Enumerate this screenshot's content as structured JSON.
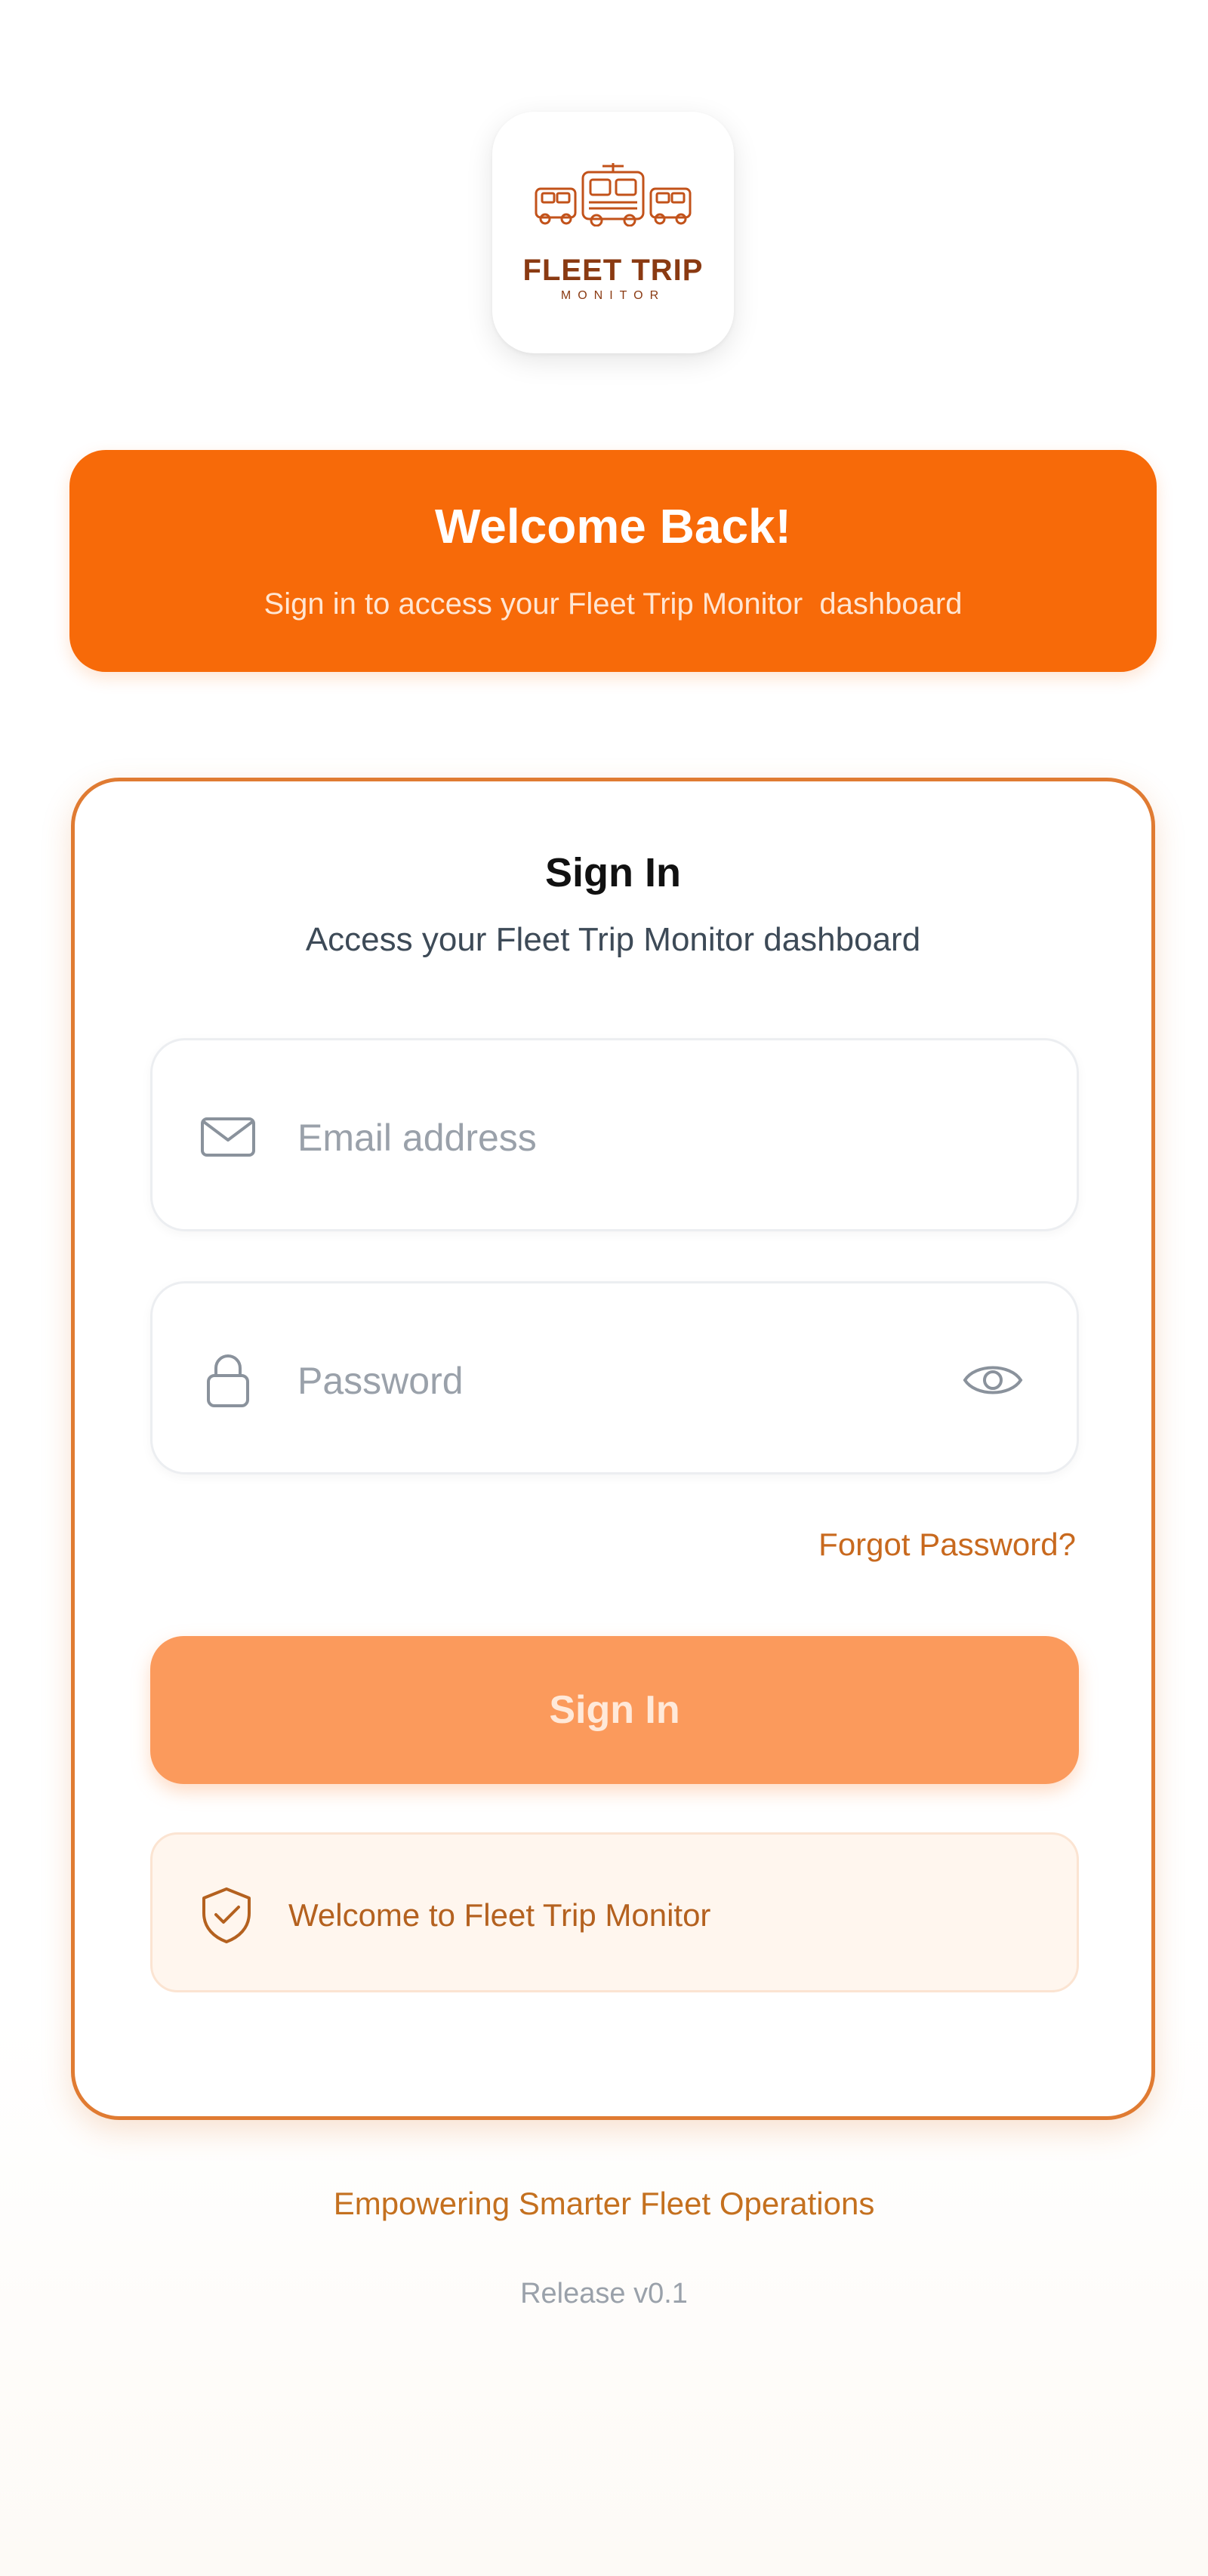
{
  "brand": {
    "logo_name": "FLEET TRIP",
    "logo_sub": "MONITOR",
    "primary_color": "#f76a09",
    "accent_color": "#e07b32",
    "logo_icon": "truck-fleet-icon"
  },
  "banner": {
    "title": "Welcome Back!",
    "subtitle": "Sign in to access your Fleet Trip Monitor  dashboard"
  },
  "signin_card": {
    "title": "Sign In",
    "subtitle": "Access your Fleet Trip Monitor dashboard",
    "email": {
      "placeholder": "Email address",
      "value": "",
      "icon": "mail-icon"
    },
    "password": {
      "placeholder": "Password",
      "value": "",
      "icon": "lock-icon",
      "toggle_icon": "eye-icon"
    },
    "forgot_password_label": "Forgot Password?",
    "submit_label": "Sign In",
    "info_message": "Welcome to Fleet Trip Monitor",
    "info_icon": "shield-check-icon"
  },
  "footer": {
    "tagline": "Empowering Smarter Fleet Operations",
    "release": "Release v0.1"
  }
}
